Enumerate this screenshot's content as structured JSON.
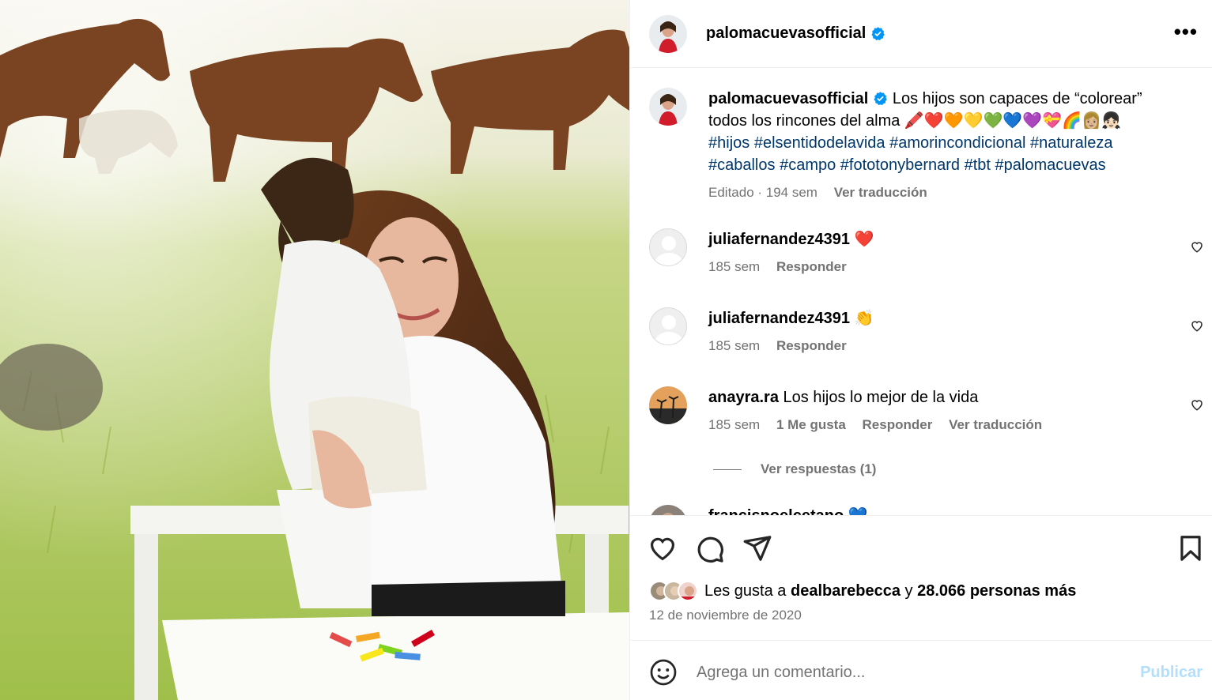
{
  "post": {
    "username": "palomacuevasofficial",
    "more_label": "•••"
  },
  "caption": {
    "username": "palomacuevasofficial",
    "text": "Los hijos son capaces de “colorear” todos los rincones del alma",
    "emoji": "🖍️❤️🧡💛💚💙💜💝🌈👩🏼👧🏻",
    "hashtags": [
      "#hijos",
      "#elsentidodelavida",
      "#amorincondicional",
      "#naturaleza",
      "#caballos",
      "#campo",
      "#fototonybernard",
      "#tbt",
      "#palomacuevas"
    ],
    "edited": "Editado · 194 sem",
    "translate": "Ver traducción"
  },
  "comments": [
    {
      "username": "juliafernandez4391",
      "text": "❤️",
      "time": "185 sem",
      "reply": "Responder"
    },
    {
      "username": "juliafernandez4391",
      "text": "👏",
      "time": "185 sem",
      "reply": "Responder"
    },
    {
      "username": "anayra.ra",
      "text": "Los hijos lo mejor de la vida",
      "time": "185 sem",
      "likes": "1 Me gusta",
      "reply": "Responder",
      "translate": "Ver traducción"
    }
  ],
  "view_replies": "Ver respuestas (1)",
  "partial_comment": {
    "username": "francisnoelcetano",
    "text": "💙"
  },
  "likes": {
    "prefix": "Les gusta a",
    "user": "dealbarebecca",
    "connector": "y",
    "count": "28.066 personas más"
  },
  "date": "12 de noviembre de 2020",
  "composer": {
    "placeholder": "Agrega un comentario...",
    "publish": "Publicar"
  },
  "colors": {
    "link": "#00376b",
    "verified": "#0095f6",
    "muted": "#737373",
    "publish_disabled": "#b2dffc",
    "heart": "#ed4956"
  },
  "icons": [
    "verified-badge-icon",
    "more-options-icon",
    "heart-icon",
    "comment-icon",
    "share-icon",
    "bookmark-icon",
    "emoji-icon"
  ]
}
